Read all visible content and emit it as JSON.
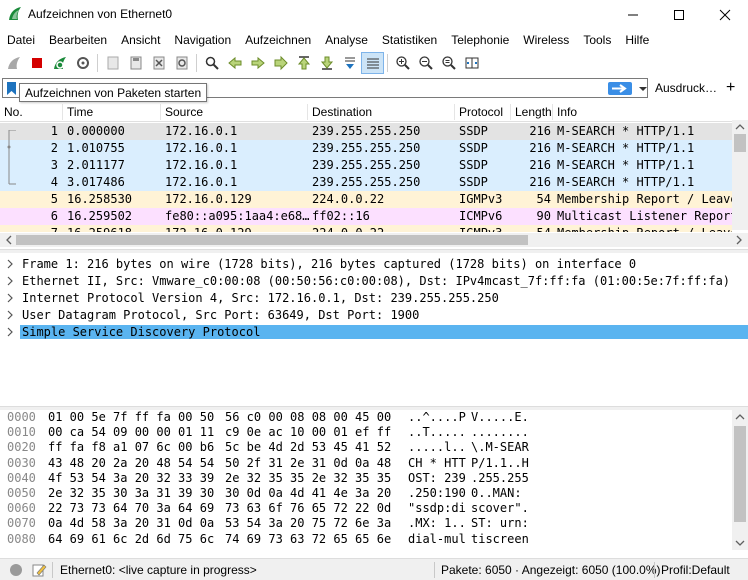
{
  "window": {
    "title": "Aufzeichnen von Ethernet0"
  },
  "menu": [
    "Datei",
    "Bearbeiten",
    "Ansicht",
    "Navigation",
    "Aufzeichnen",
    "Analyse",
    "Statistiken",
    "Telephonie",
    "Wireless",
    "Tools",
    "Hilfe"
  ],
  "filter": {
    "value": "",
    "expression_label": "Ausdruck…",
    "plus": "+"
  },
  "tooltip": "Aufzeichnen von Paketen starten",
  "packet_list": {
    "columns": [
      "No.",
      "Time",
      "Source",
      "Destination",
      "Protocol",
      "Length",
      "Info"
    ],
    "rows": [
      {
        "no": "1",
        "time": "0.000000",
        "src": "172.16.0.1",
        "dst": "239.255.255.250",
        "proto": "SSDP",
        "len": "216",
        "info": "M-SEARCH * HTTP/1.1",
        "bg": "#e3e3e3"
      },
      {
        "no": "2",
        "time": "1.010755",
        "src": "172.16.0.1",
        "dst": "239.255.255.250",
        "proto": "SSDP",
        "len": "216",
        "info": "M-SEARCH * HTTP/1.1",
        "bg": "#daeefe"
      },
      {
        "no": "3",
        "time": "2.011177",
        "src": "172.16.0.1",
        "dst": "239.255.255.250",
        "proto": "SSDP",
        "len": "216",
        "info": "M-SEARCH * HTTP/1.1",
        "bg": "#daeefe"
      },
      {
        "no": "4",
        "time": "3.017486",
        "src": "172.16.0.1",
        "dst": "239.255.255.250",
        "proto": "SSDP",
        "len": "216",
        "info": "M-SEARCH * HTTP/1.1",
        "bg": "#daeefe"
      },
      {
        "no": "5",
        "time": "16.258530",
        "src": "172.16.0.129",
        "dst": "224.0.0.22",
        "proto": "IGMPv3",
        "len": "54",
        "info": "Membership Report / Leave",
        "bg": "#fff3d6"
      },
      {
        "no": "6",
        "time": "16.259502",
        "src": "fe80::a095:1aa4:e68…",
        "dst": "ff02::16",
        "proto": "ICMPv6",
        "len": "90",
        "info": "Multicast Listener Report",
        "bg": "#fce0ff"
      },
      {
        "no": "7",
        "time": "16.259618",
        "src": "172.16.0.129",
        "dst": "224.0.0.22",
        "proto": "IGMPv3",
        "len": "54",
        "info": "Membership Report / Leave",
        "bg": "#fff3d6"
      }
    ]
  },
  "details": [
    "Frame 1: 216 bytes on wire (1728 bits), 216 bytes captured (1728 bits) on interface 0",
    "Ethernet II, Src: Vmware_c0:00:08 (00:50:56:c0:00:08), Dst: IPv4mcast_7f:ff:fa (01:00:5e:7f:ff:fa)",
    "Internet Protocol Version 4, Src: 172.16.0.1, Dst: 239.255.255.250",
    "User Datagram Protocol, Src Port: 63649, Dst Port: 1900",
    "Simple Service Discovery Protocol"
  ],
  "hex": [
    {
      "off": "0000",
      "b1": "01 00 5e 7f ff fa 00 50",
      "b2": "56 c0 00 08 08 00 45 00",
      "a1": "..^....P",
      "a2": "V.....E."
    },
    {
      "off": "0010",
      "b1": "00 ca 54 09 00 00 01 11",
      "b2": "c9 0e ac 10 00 01 ef ff",
      "a1": "..T.....",
      "a2": "........"
    },
    {
      "off": "0020",
      "b1": "ff fa f8 a1 07 6c 00 b6",
      "b2": "5c be 4d 2d 53 45 41 52",
      "a1": ".....l..",
      "a2": "\\.M-SEAR"
    },
    {
      "off": "0030",
      "b1": "43 48 20 2a 20 48 54 54",
      "b2": "50 2f 31 2e 31 0d 0a 48",
      "a1": "CH * HTT",
      "a2": "P/1.1..H"
    },
    {
      "off": "0040",
      "b1": "4f 53 54 3a 20 32 33 39",
      "b2": "2e 32 35 35 2e 32 35 35",
      "a1": "OST: 239",
      ".a2": "",
      "a2": ".255.255"
    },
    {
      "off": "0050",
      "b1": "2e 32 35 30 3a 31 39 30",
      "b2": "30 0d 0a 4d 41 4e 3a 20",
      "a1": ".250:190",
      "a2": "0..MAN: "
    },
    {
      "off": "0060",
      "b1": "22 73 73 64 70 3a 64 69",
      "b2": "73 63 6f 76 65 72 22 0d",
      "a1": "\"ssdp:di",
      "a2": "scover\"."
    },
    {
      "off": "0070",
      "b1": "0a 4d 58 3a 20 31 0d 0a",
      "b2": "53 54 3a 20 75 72 6e 3a",
      "a1": ".MX: 1..",
      "a2": "ST: urn:"
    },
    {
      "off": "0080",
      "b1": "64 69 61 6c 2d 6d 75 6c",
      "b2": "74 69 73 63 72 65 65 6e",
      "a1": "dial-mul",
      "a2": "tiscreen"
    }
  ],
  "status": {
    "interface": "Ethernet0: <live capture in progress>",
    "packets": "Pakete: 6050 · Angezeigt: 6050 (100.0%)",
    "profile": "Profil:Default"
  },
  "colors": {
    "selected_detail": "#5ab4f0",
    "accent": "#1e73be"
  }
}
